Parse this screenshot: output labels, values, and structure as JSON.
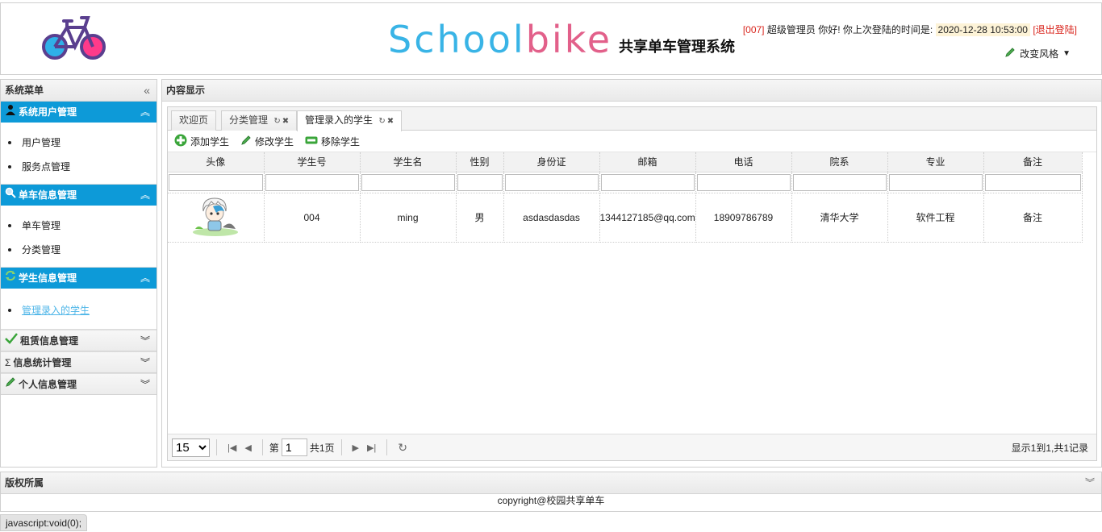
{
  "header": {
    "brand_school": "School",
    "brand_bike": "bike",
    "brand_system": "共享单车管理系统",
    "user_id": "[007]",
    "user_greeting": "超级管理员 你好! 你上次登陆的时间是:",
    "last_login": "2020-12-28 10:53:00",
    "logout": "[退出登陆]",
    "theme_label": "改变风格"
  },
  "sidebar": {
    "title": "系统菜单",
    "groups": [
      {
        "label": "系统用户管理",
        "icon": "user-icon",
        "expanded": true,
        "items": [
          "用户管理",
          "服务点管理"
        ]
      },
      {
        "label": "单车信息管理",
        "icon": "search-icon",
        "expanded": true,
        "items": [
          "单车管理",
          "分类管理"
        ]
      },
      {
        "label": "学生信息管理",
        "icon": "refresh-icon",
        "expanded": true,
        "items": [
          "管理录入的学生"
        ]
      },
      {
        "label": "租赁信息管理",
        "icon": "check-icon",
        "expanded": false
      },
      {
        "label": "信息统计管理",
        "icon": "sigma-icon",
        "expanded": false
      },
      {
        "label": "个人信息管理",
        "icon": "pencil-icon",
        "expanded": false
      }
    ]
  },
  "content": {
    "title": "内容显示",
    "tabs": [
      "欢迎页",
      "分类管理",
      "管理录入的学生"
    ],
    "toolbar": {
      "add": "添加学生",
      "edit": "修改学生",
      "remove": "移除学生"
    },
    "columns": [
      "头像",
      "学生号",
      "学生名",
      "性别",
      "身份证",
      "邮箱",
      "电话",
      "院系",
      "专业",
      "备注"
    ],
    "rows": [
      {
        "student_no": "004",
        "name": "ming",
        "gender": "男",
        "id_card": "asdasdasdas",
        "email": "1344127185@qq.com",
        "phone": "18909786789",
        "department": "清华大学",
        "major": "软件工程",
        "remark": "备注"
      }
    ],
    "pager": {
      "page_size": "15",
      "page_prefix": "第",
      "page_value": "1",
      "page_total": "共1页",
      "info": "显示1到1,共1记录"
    }
  },
  "footer": {
    "title": "版权所属",
    "copyright": "copyright@校园共享单车"
  },
  "statusbar": "javascript:void(0);"
}
